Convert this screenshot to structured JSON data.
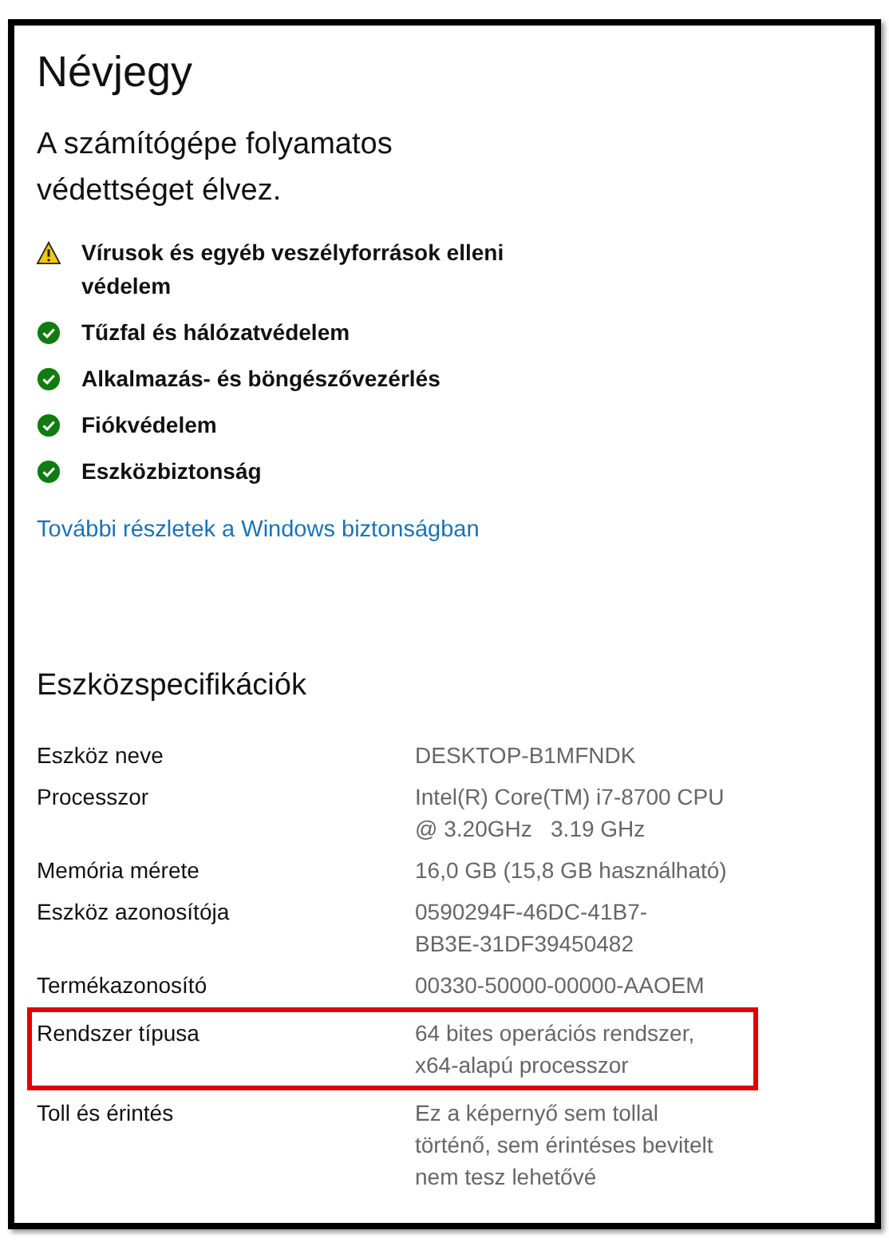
{
  "title": "Névjegy",
  "protection": {
    "message": "A számítógépe folyamatos\nvédettséget élvez.",
    "items": [
      {
        "kind": "warning",
        "label": "Vírusok és egyéb veszélyforrások elleni\nvédelem"
      },
      {
        "kind": "ok",
        "label": "Tűzfal és hálózatvédelem"
      },
      {
        "kind": "ok",
        "label": "Alkalmazás- és böngészővezérlés"
      },
      {
        "kind": "ok",
        "label": "Fiókvédelem"
      },
      {
        "kind": "ok",
        "label": "Eszközbiztonság"
      }
    ],
    "link": "További részletek a Windows biztonságban"
  },
  "specs": {
    "heading": "Eszközspecifikációk",
    "rows": [
      {
        "label": "Eszköz neve",
        "value": "DESKTOP-B1MFNDK",
        "highlighted": false
      },
      {
        "label": "Processzor",
        "value": "Intel(R) Core(TM) i7-8700 CPU\n@ 3.20GHz   3.19 GHz",
        "highlighted": false
      },
      {
        "label": "Memória mérete",
        "value": "16,0 GB (15,8 GB használható)",
        "highlighted": false
      },
      {
        "label": "Eszköz azonosítója",
        "value": "0590294F-46DC-41B7-\nBB3E-31DF39450482",
        "highlighted": false
      },
      {
        "label": "Termékazonosító",
        "value": "00330-50000-00000-AAOEM",
        "highlighted": false
      },
      {
        "label": "Rendszer típusa",
        "value": "64 bites operációs rendszer,\nx64-alapú processzor",
        "highlighted": true
      },
      {
        "label": "Toll és érintés",
        "value": "Ez a képernyő sem tollal\ntörténő, sem érintéses bevitelt\nnem tesz lehetővé",
        "highlighted": false
      }
    ]
  }
}
